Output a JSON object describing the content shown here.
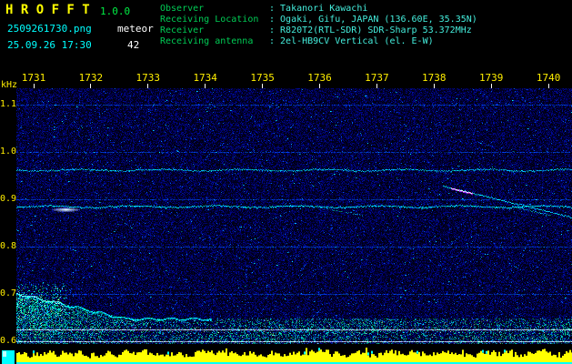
{
  "colors": {
    "background": "#000000",
    "title_yellow": "#ffff00",
    "version_green": "#00ee44",
    "label_green": "#00cc55",
    "value_cyan": "#44eedd",
    "cyan": "#00ffff",
    "white": "#ffffff",
    "axis_yellow": "#ffee00"
  },
  "header": {
    "app_name": "H R O F F T",
    "version": "1.0.0",
    "filename": "2509261730.png",
    "mode": "meteor",
    "datetime": "25.09.26 17:30",
    "echo_count": "42",
    "info": [
      {
        "label": "Observer",
        "value": ": Takanori Kawachi"
      },
      {
        "label": "Receiving Location",
        "value": ": Ogaki, Gifu, JAPAN (136.60E, 35.35N)"
      },
      {
        "label": "Receiver",
        "value": ": R820T2(RTL-SDR) SDR-Sharp 53.372MHz"
      },
      {
        "label": "Receiving antenna",
        "value": ": 2el-HB9CV Vertical (el. E-W)"
      }
    ]
  },
  "chart_data": {
    "type": "heatmap",
    "y_unit": "kHz",
    "x_ticks": [
      "1731",
      "1732",
      "1733",
      "1734",
      "1735",
      "1736",
      "1737",
      "1738",
      "1739",
      "1740"
    ],
    "y_ticks": [
      "1.1",
      "1.0",
      "0.9",
      "0.8",
      "0.7",
      "0.6"
    ],
    "y_range": [
      0.595,
      1.135
    ],
    "grid": "faint horizontal blue line at each 0.1 kHz tick",
    "background_noise": "dark blue speckle",
    "carriers_khz": [
      0.962,
      0.885
    ],
    "carrier_hotspot": {
      "khz": 0.878,
      "near_x_tick": "1731",
      "color": "#ffffff"
    },
    "echo_trail": {
      "start_near_x_tick": "1738",
      "start_khz": 0.928,
      "end_khz": 0.862,
      "head_color": "#ff3cc8"
    },
    "echo_trail_secondary": {
      "x_span_ticks": [
        "1736",
        "1737"
      ],
      "khz": 0.88
    },
    "noise_band": {
      "khz_low": 0.6,
      "khz_high": 0.7,
      "stronger_left_edge": true,
      "color": "#00cc66"
    },
    "marker_lines_khz": [
      0.625,
      0.599
    ],
    "bottom_meter": {
      "bar_color": "#ffff00",
      "base_color": "#00ffff"
    }
  }
}
